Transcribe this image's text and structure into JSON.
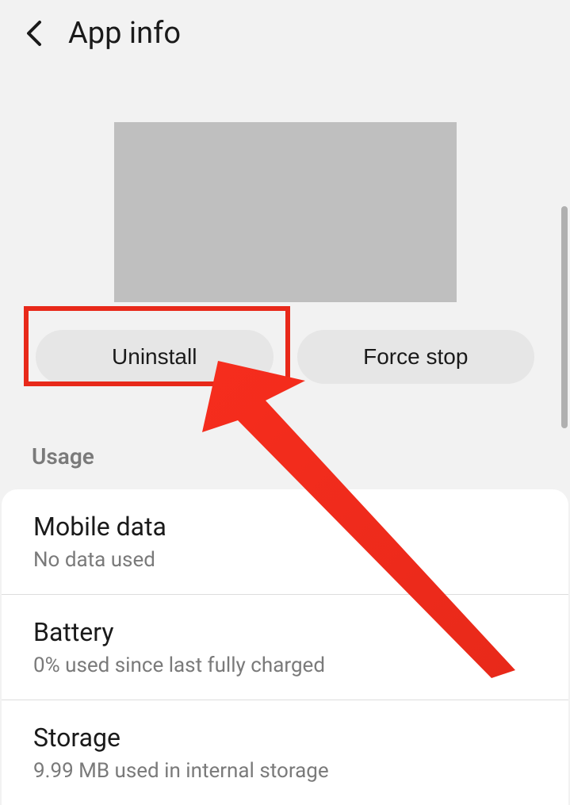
{
  "header": {
    "title": "App info"
  },
  "actions": {
    "uninstall_label": "Uninstall",
    "force_stop_label": "Force stop"
  },
  "section": {
    "usage_label": "Usage"
  },
  "usage": {
    "items": [
      {
        "title": "Mobile data",
        "subtitle": "No data used"
      },
      {
        "title": "Battery",
        "subtitle": "0% used since last fully charged"
      },
      {
        "title": "Storage",
        "subtitle": "9.99 MB used in internal storage"
      }
    ]
  },
  "annotation": {
    "highlight_color": "#e8291a",
    "arrow_color": "#f62d1d"
  }
}
